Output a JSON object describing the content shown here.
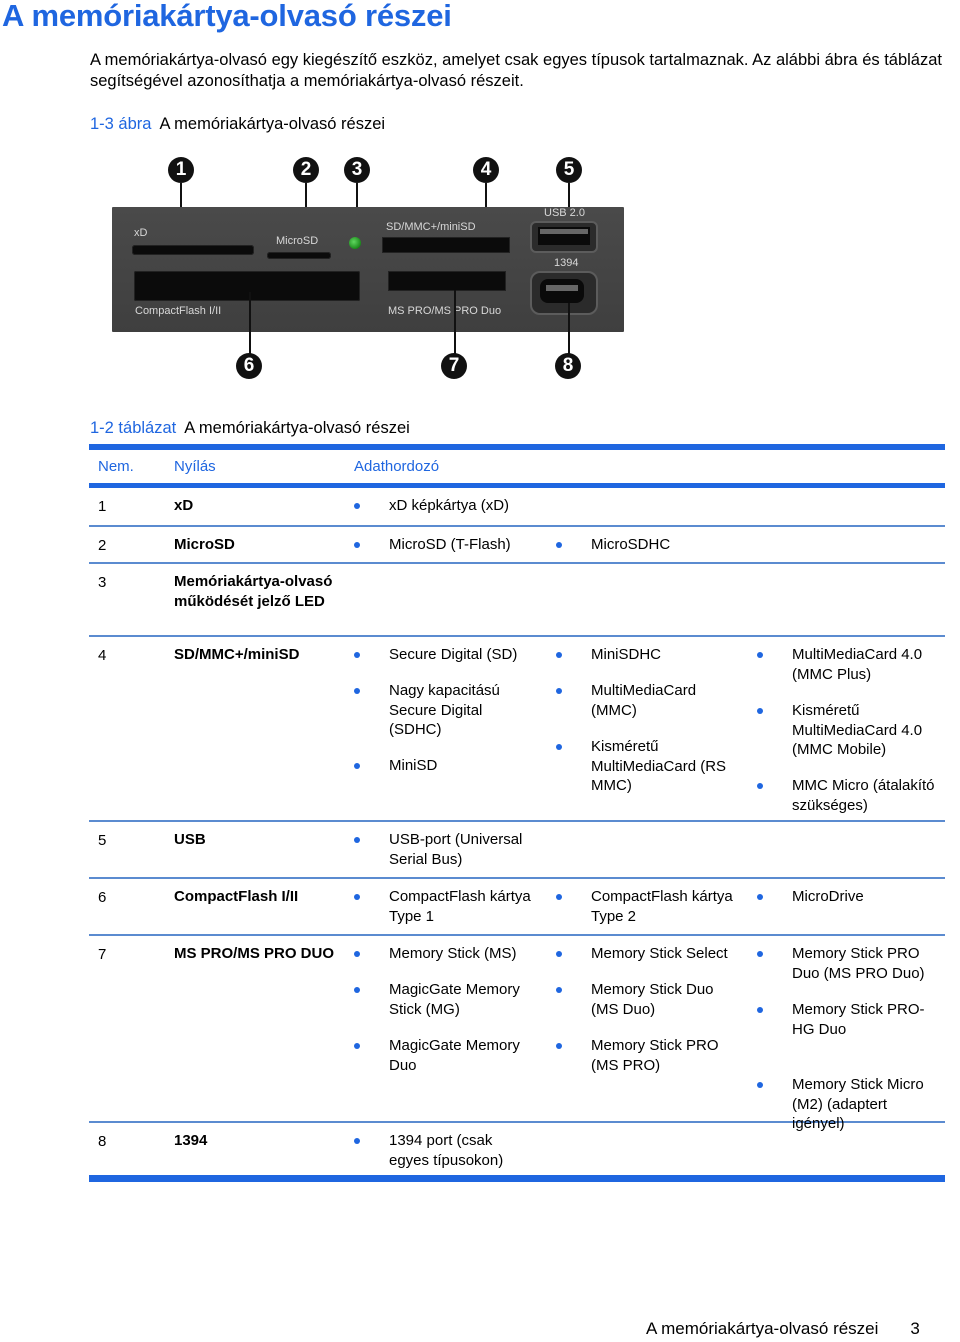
{
  "page": {
    "title": "A memóriakártya-olvasó részei",
    "intro": "A memóriakártya-olvasó egy kiegészítő eszköz, amelyet csak egyes típusok tartalmaznak. Az alábbi ábra és táblázat segítségével azonosíthatja a memóriakártya-olvasó részeit."
  },
  "figure": {
    "caption_num": "1-3 ábra",
    "caption_text": "A memóriakártya-olvasó részei",
    "callouts": [
      "1",
      "2",
      "3",
      "4",
      "5",
      "6",
      "7",
      "8"
    ],
    "panel_labels": {
      "xd": "xD",
      "microsd": "MicroSD",
      "sd": "SD/MMC+/miniSD",
      "usb": "USB 2.0",
      "fw": "1394",
      "cf": "CompactFlash I/II",
      "ms": "MS PRO/MS PRO Duo"
    },
    "led_color": "#2fae2f"
  },
  "table": {
    "caption_num": "1-2 táblázat",
    "caption_text": "A memóriakártya-olvasó részei",
    "headers": [
      "Nem.",
      "Nyílás",
      "Adathordozó"
    ],
    "accent_color": "#1f66e0",
    "rows": [
      {
        "num": "1",
        "slot": "xD",
        "media": [
          [
            "xD képkártya (xD)"
          ]
        ]
      },
      {
        "num": "2",
        "slot": "MicroSD",
        "media": [
          [
            "MicroSD (T-Flash)"
          ],
          [
            "MicroSDHC"
          ]
        ]
      },
      {
        "num": "3",
        "slot": "Memóriakártya-olvasó működését jelző LED",
        "media": []
      },
      {
        "num": "4",
        "slot": "SD/MMC+/miniSD",
        "media": [
          [
            "Secure Digital (SD)",
            "Nagy kapacitású Secure Digital (SDHC)",
            "MiniSD"
          ],
          [
            "MiniSDHC",
            "MultiMediaCard (MMC)",
            "Kisméretű MultiMediaCard (RS MMC)"
          ],
          [
            "MultiMediaCard 4.0 (MMC Plus)",
            "Kisméretű MultiMediaCard 4.0 (MMC Mobile)",
            "MMC Micro (átalakító szükséges)"
          ]
        ]
      },
      {
        "num": "5",
        "slot": "USB",
        "media": [
          [
            "USB-port (Universal Serial Bus)"
          ]
        ]
      },
      {
        "num": "6",
        "slot": "CompactFlash I/II",
        "media": [
          [
            "CompactFlash kártya Type 1"
          ],
          [
            "CompactFlash kártya Type 2"
          ],
          [
            "MicroDrive"
          ]
        ]
      },
      {
        "num": "7",
        "slot": "MS PRO/MS PRO DUO",
        "media": [
          [
            "Memory Stick (MS)",
            "MagicGate Memory Stick (MG)",
            "MagicGate Memory Duo"
          ],
          [
            "Memory Stick Select",
            "Memory Stick Duo (MS Duo)",
            "Memory Stick PRO (MS PRO)"
          ],
          [
            "Memory Stick PRO Duo (MS PRO Duo)",
            "Memory Stick PRO-HG Duo",
            "Memory Stick Micro (M2) (adaptert igényel)"
          ]
        ]
      },
      {
        "num": "8",
        "slot": "1394",
        "media": [
          [
            "1394 port (csak egyes típusokon)"
          ]
        ]
      }
    ]
  },
  "footer": {
    "section": "A memóriakártya-olvasó részei",
    "page_number": "3"
  }
}
